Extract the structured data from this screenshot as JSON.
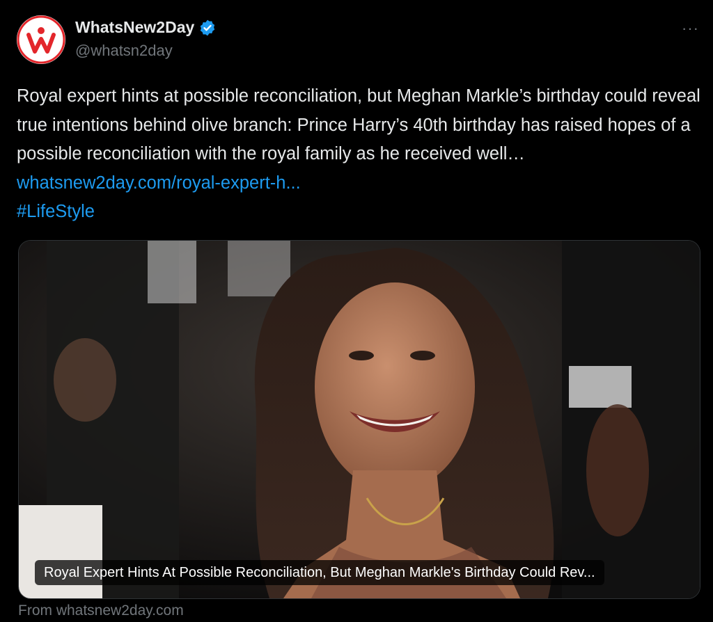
{
  "account": {
    "display_name": "WhatsNew2Day",
    "handle": "@whatsn2day",
    "avatar_icon": "whatsnew2day-logo",
    "verified_icon": "verified-badge-icon",
    "more_label": "···"
  },
  "tweet": {
    "body": "Royal expert hints at possible reconciliation, but Meghan Markle’s birthday could reveal true intentions behind olive branch: Prince Harry’s 40th birthday has raised hopes of a possible reconciliation with the royal family as he received well…",
    "link_text": "whatsnew2day.com/royal-expert-h...",
    "hashtag": "#LifeStyle"
  },
  "card": {
    "caption": "Royal Expert Hints At Possible Reconciliation, But Meghan Markle's Birthday Could Rev...",
    "source": "From whatsnew2day.com"
  },
  "colors": {
    "background": "#000000",
    "text": "#e7e9ea",
    "secondary": "#71767b",
    "link": "#1d9bf0",
    "logo_red": "#e3262b"
  }
}
